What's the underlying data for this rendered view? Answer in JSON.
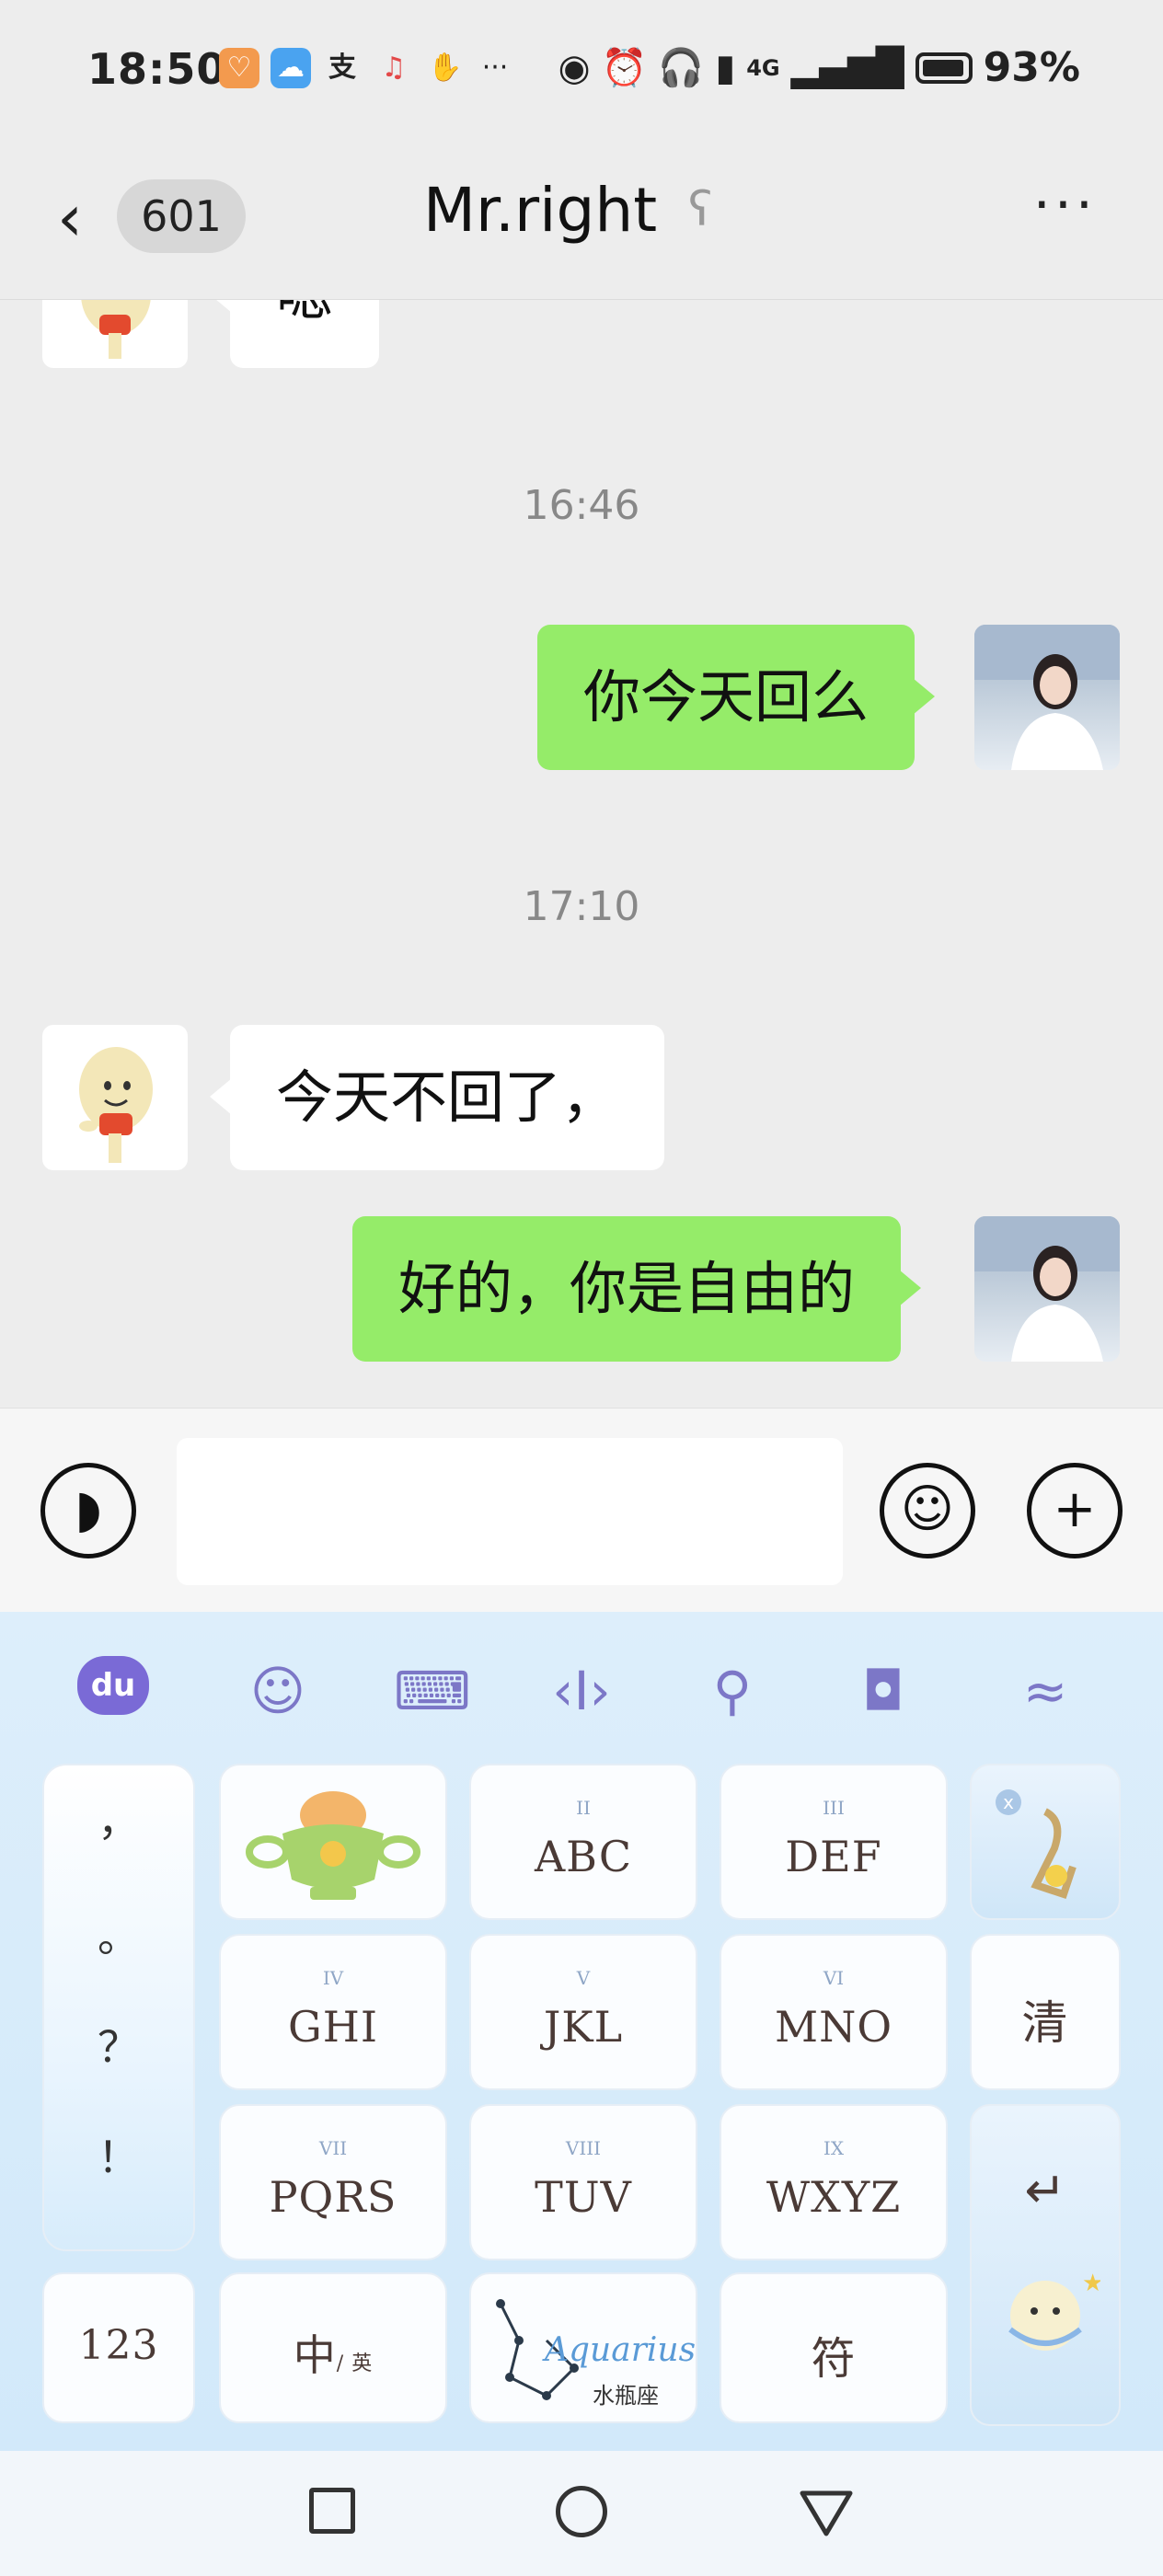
{
  "status_bar": {
    "time": "18:50",
    "network_label": "4G",
    "battery_percent": "93%",
    "icons": [
      "app-notification-icon",
      "weather-icon",
      "alipay-icon",
      "music-icon",
      "hand-icon",
      "more-dots-icon",
      "eye-icon",
      "alarm-icon",
      "headphones-icon",
      "vibrate-icon",
      "signal-icon",
      "battery-icon"
    ]
  },
  "header": {
    "back_icon": "chevron-left-icon",
    "unread_count": "601",
    "title": "Mr.right",
    "earpiece_icon": "ear-icon",
    "more_label": "···"
  },
  "chat": {
    "messages": [
      {
        "side": "left",
        "text": "嗯",
        "partial": true
      },
      {
        "timestamp": "16:46"
      },
      {
        "side": "right",
        "text": "你今天回么"
      },
      {
        "timestamp": "17:10"
      },
      {
        "side": "left",
        "text": "今天不回了，"
      },
      {
        "side": "right",
        "text": "好的，你是自由的"
      }
    ]
  },
  "input_bar": {
    "voice_icon": "voice-icon",
    "emoji_icon": "emoji-icon",
    "plus_icon": "plus-icon",
    "text_value": ""
  },
  "keyboard": {
    "toolbar": [
      "du-logo",
      "smile-icon",
      "keyboard-icon",
      "cursor-icon",
      "search-icon",
      "clipboard-icon",
      "wave-icon"
    ],
    "logo_label": "du",
    "punctuation": [
      "，",
      "。",
      "？",
      "！"
    ],
    "keys": [
      {
        "roman": "",
        "label": ""
      },
      {
        "roman": "II",
        "label": "ABC"
      },
      {
        "roman": "III",
        "label": "DEF"
      },
      {
        "roman": "IV",
        "label": "GHI"
      },
      {
        "roman": "V",
        "label": "JKL"
      },
      {
        "roman": "VI",
        "label": "MNO"
      },
      {
        "roman": "VII",
        "label": "PQRS"
      },
      {
        "roman": "VIII",
        "label": "TUV"
      },
      {
        "roman": "IX",
        "label": "WXYZ"
      }
    ],
    "clear_label": "清",
    "num_label": "123",
    "lang_label_main": "中",
    "lang_label_sub": "/ 英",
    "space_label": "Aquarius",
    "space_sub": "水瓶座",
    "symbol_label": "符",
    "enter_label": "↵"
  },
  "nav_bar": {
    "icons": [
      "recent-apps-icon",
      "home-icon",
      "back-triangle-icon"
    ]
  }
}
